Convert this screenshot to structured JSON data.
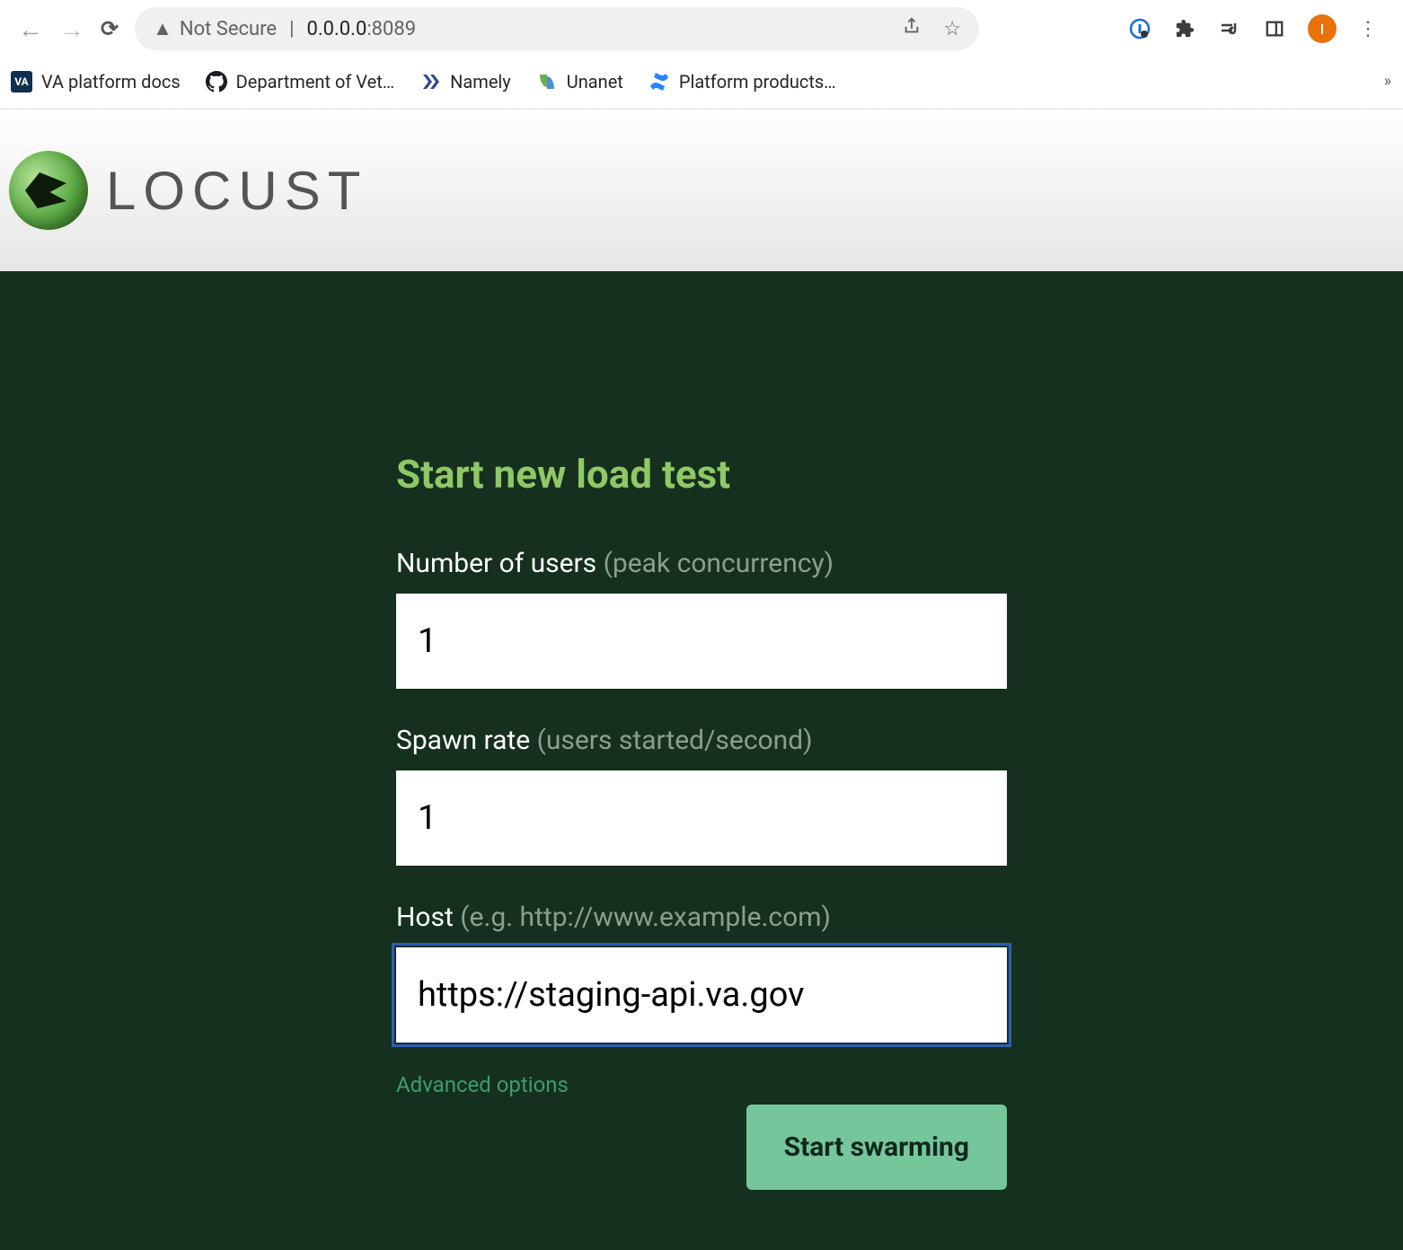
{
  "browser": {
    "not_secure_label": "Not Secure",
    "url_host": "0.0.0.0",
    "url_port": ":8089",
    "avatar_letter": "I"
  },
  "bookmarks": {
    "va_docs": "VA platform docs",
    "dept_vet": "Department of Vet…",
    "namely": "Namely",
    "unanet": "Unanet",
    "platform": "Platform products…",
    "overflow": "»"
  },
  "locust": {
    "brand": "LOCUST",
    "heading": "Start new load test",
    "users_label": "Number of users",
    "users_hint": "(peak concurrency)",
    "users_value": "1",
    "spawn_label": "Spawn rate",
    "spawn_hint": "(users started/second)",
    "spawn_value": "1",
    "host_label": "Host",
    "host_hint": "(e.g. http://www.example.com)",
    "host_value": "https://staging-api.va.gov",
    "advanced": "Advanced options",
    "submit": "Start swarming"
  }
}
